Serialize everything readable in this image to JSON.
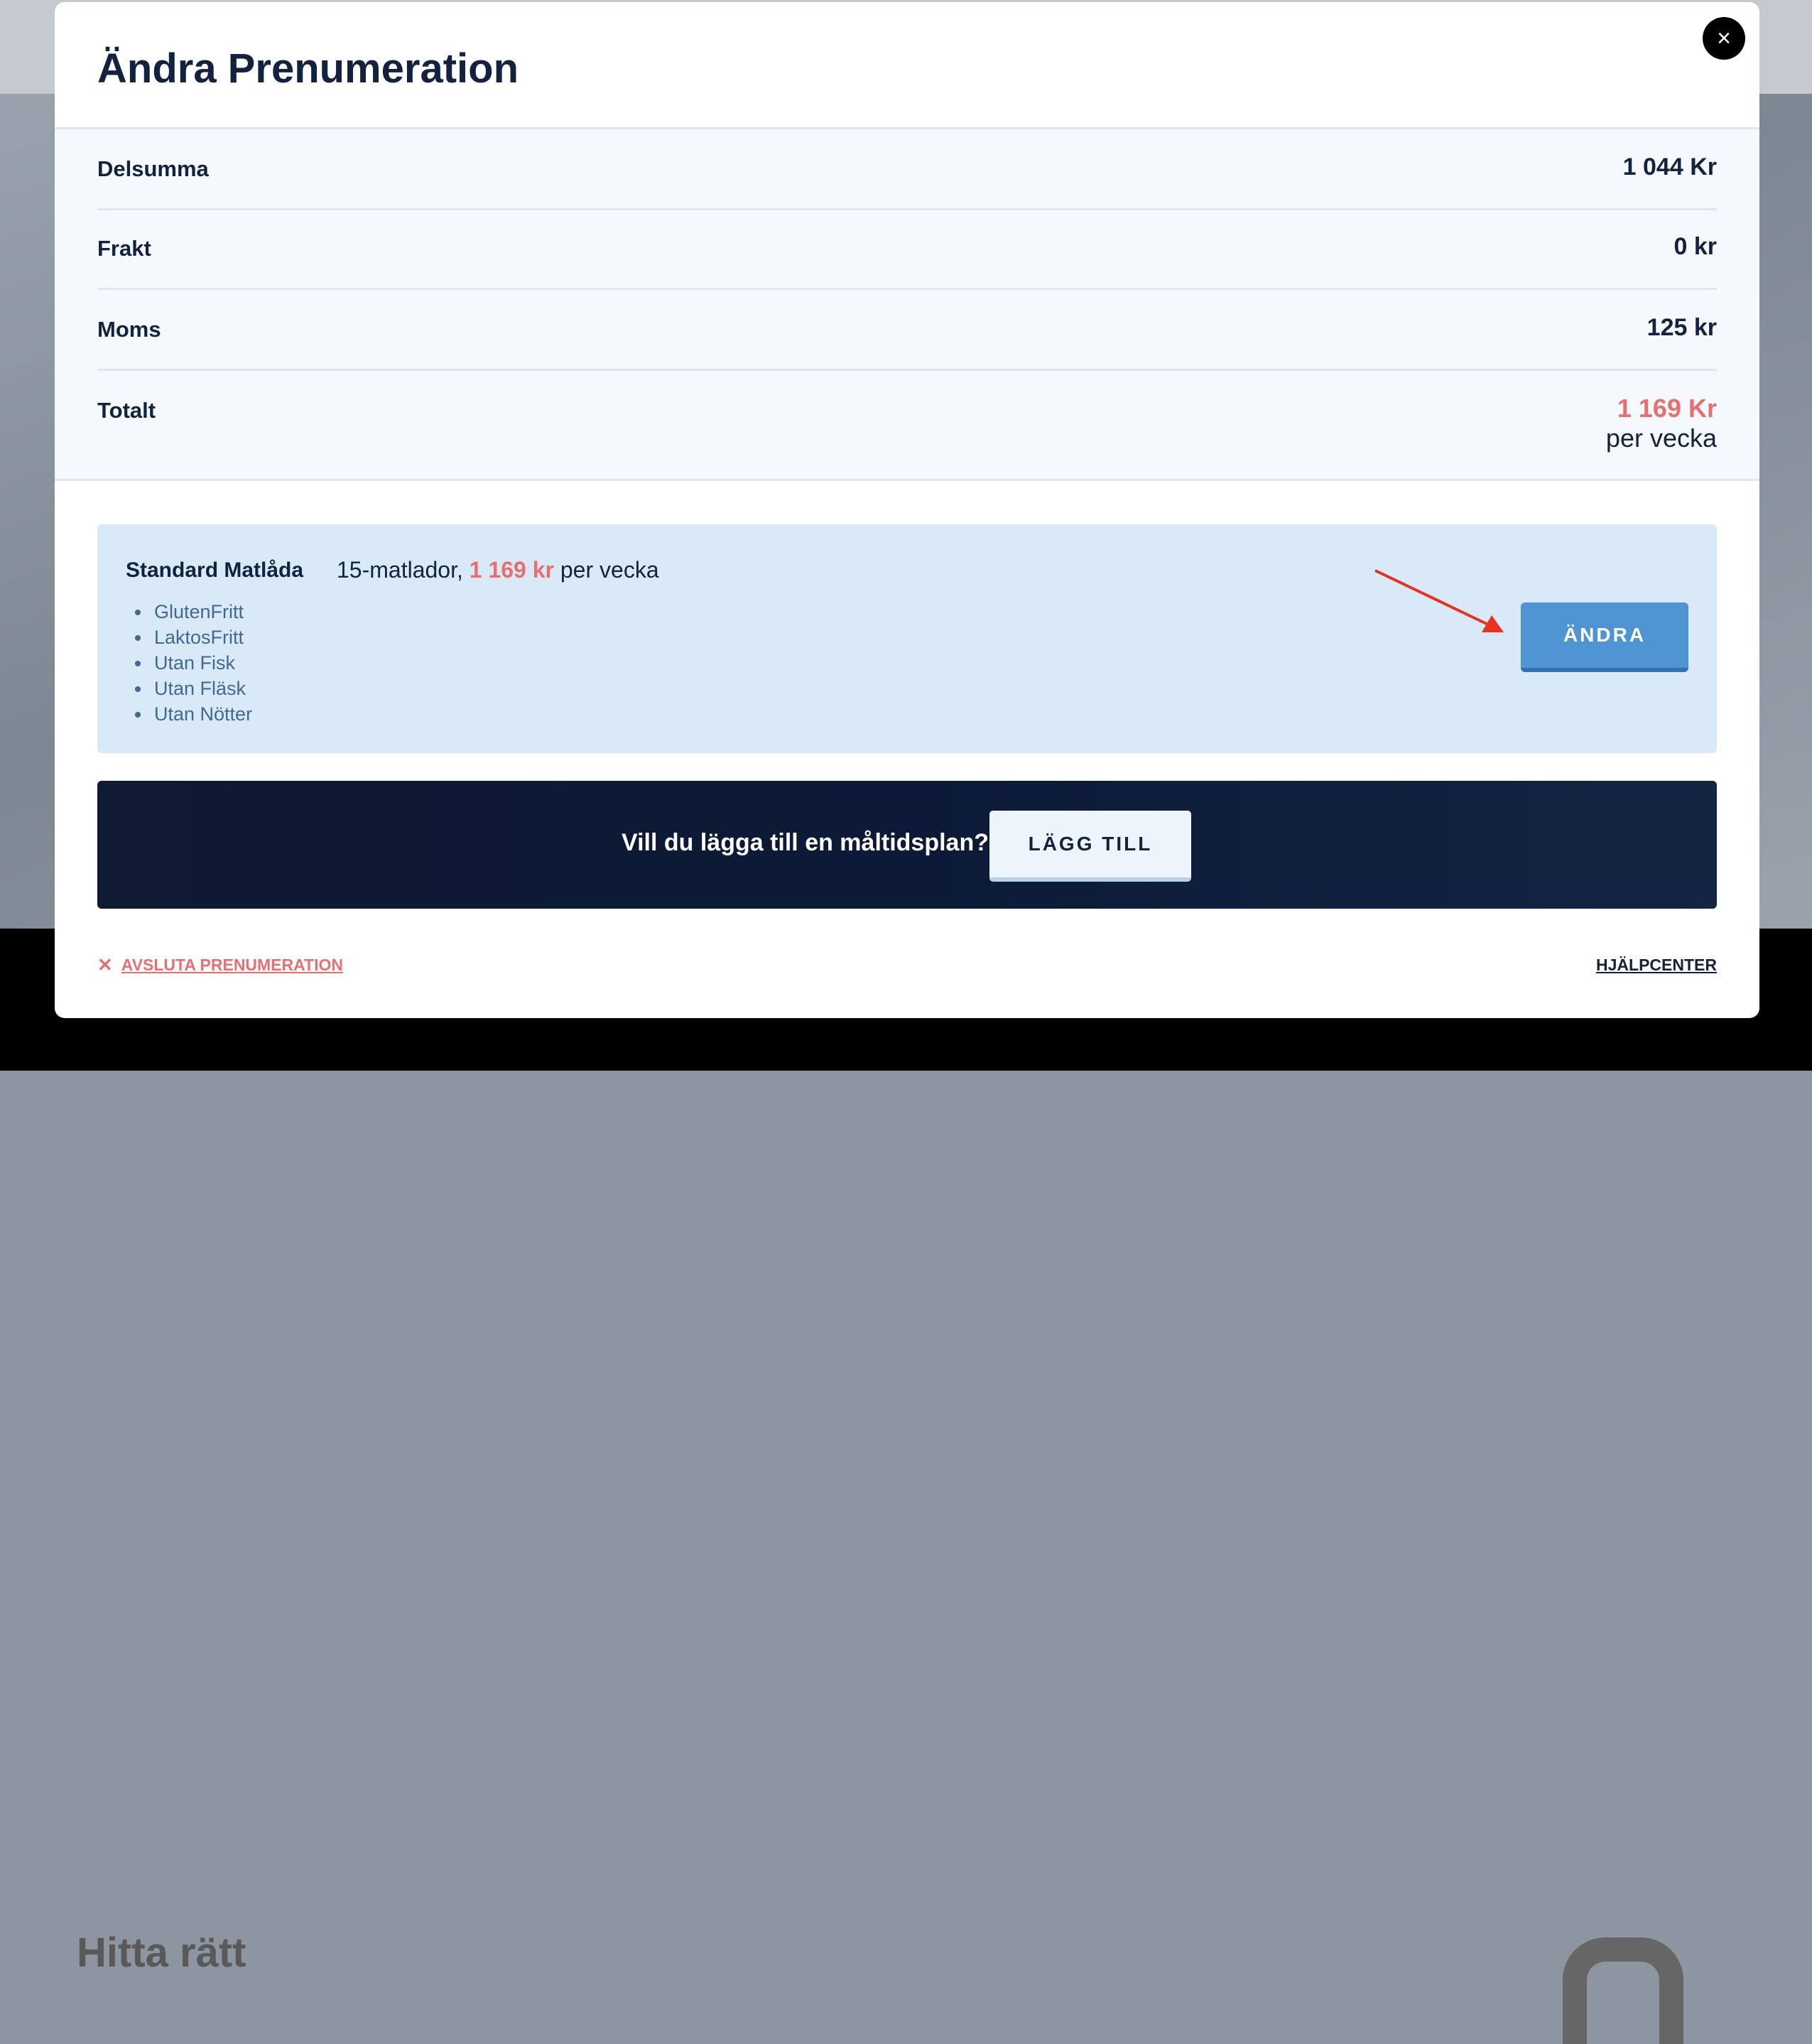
{
  "background": {
    "heading": "Hitta rätt"
  },
  "modal": {
    "title": "Ändra Prenumeration",
    "close_icon": "×"
  },
  "summary": {
    "rows": [
      {
        "label": "Delsumma",
        "value": "1 044 Kr"
      },
      {
        "label": "Frakt",
        "value": "0 kr"
      },
      {
        "label": "Moms",
        "value": "125 kr"
      }
    ],
    "total": {
      "label": "Totalt",
      "value": "1 169 Kr",
      "period": "per vecka"
    }
  },
  "plan": {
    "name": "Standard Matlåda",
    "count": "15-matlador,",
    "price": "1 169 kr",
    "period": "per vecka",
    "tags": [
      "GlutenFritt",
      "LaktosFritt",
      "Utan Fisk",
      "Utan Fläsk",
      "Utan Nötter"
    ],
    "change_label": "ÄNDRA"
  },
  "addon": {
    "prompt": "Vill du lägga till en måltidsplan?",
    "add_label": "LÄGG TILL"
  },
  "footer": {
    "cancel_icon": "✕",
    "cancel_label": "AVSLUTA PRENUMERATION",
    "help_label": "HJÄLPCENTER"
  },
  "colors": {
    "navy": "#12223f",
    "accent_red": "#e86f6f",
    "button_blue": "#4f94d3",
    "card_blue": "#d9e9f8"
  }
}
